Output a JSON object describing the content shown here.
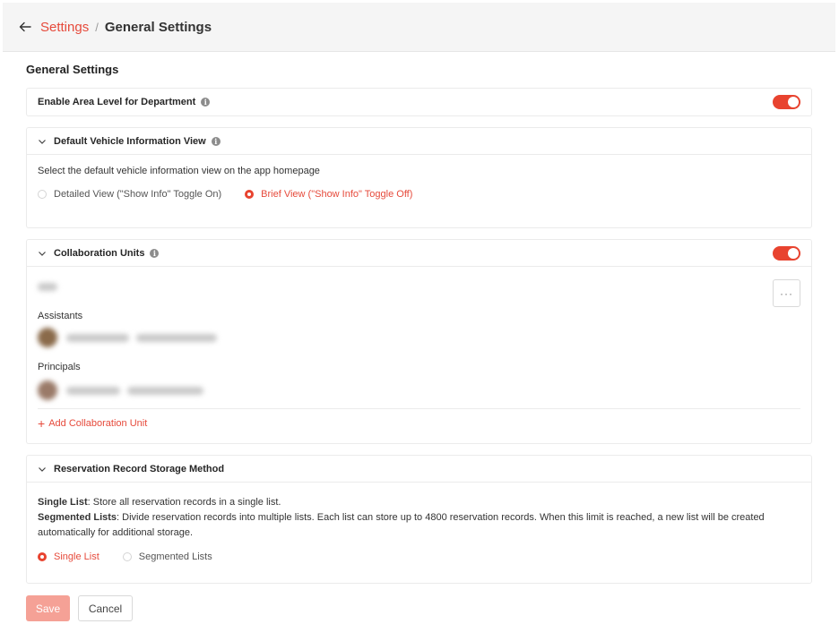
{
  "header": {
    "breadcrumb_root": "Settings",
    "breadcrumb_separator": "/",
    "breadcrumb_current": "General Settings"
  },
  "page_title": "General Settings",
  "area_level": {
    "label": "Enable Area Level for Department",
    "enabled": true
  },
  "vehicle_view": {
    "title": "Default Vehicle Information View",
    "description": "Select the default vehicle information view on the app homepage",
    "options": [
      {
        "label": "Detailed View (\"Show Info\" Toggle On)",
        "selected": false
      },
      {
        "label": "Brief View (\"Show Info\" Toggle Off)",
        "selected": true
      }
    ]
  },
  "collaboration": {
    "title": "Collaboration Units",
    "enabled": true,
    "more_label": "···",
    "assistants_label": "Assistants",
    "principals_label": "Principals",
    "add_label": "Add Collaboration Unit"
  },
  "storage": {
    "title": "Reservation Record Storage Method",
    "single_term": "Single List",
    "single_desc": ": Store all reservation records in a single list.",
    "segmented_term": "Segmented Lists",
    "segmented_desc": ": Divide reservation records into multiple lists. Each list can store up to 4800 reservation records. When this limit is reached, a new list will be created automatically for additional storage.",
    "options": [
      {
        "label": "Single List",
        "selected": true
      },
      {
        "label": "Segmented Lists",
        "selected": false
      }
    ]
  },
  "actions": {
    "save_label": "Save",
    "cancel_label": "Cancel"
  },
  "colors": {
    "accent": "#e8432f",
    "save_disabled": "#f5a196"
  }
}
